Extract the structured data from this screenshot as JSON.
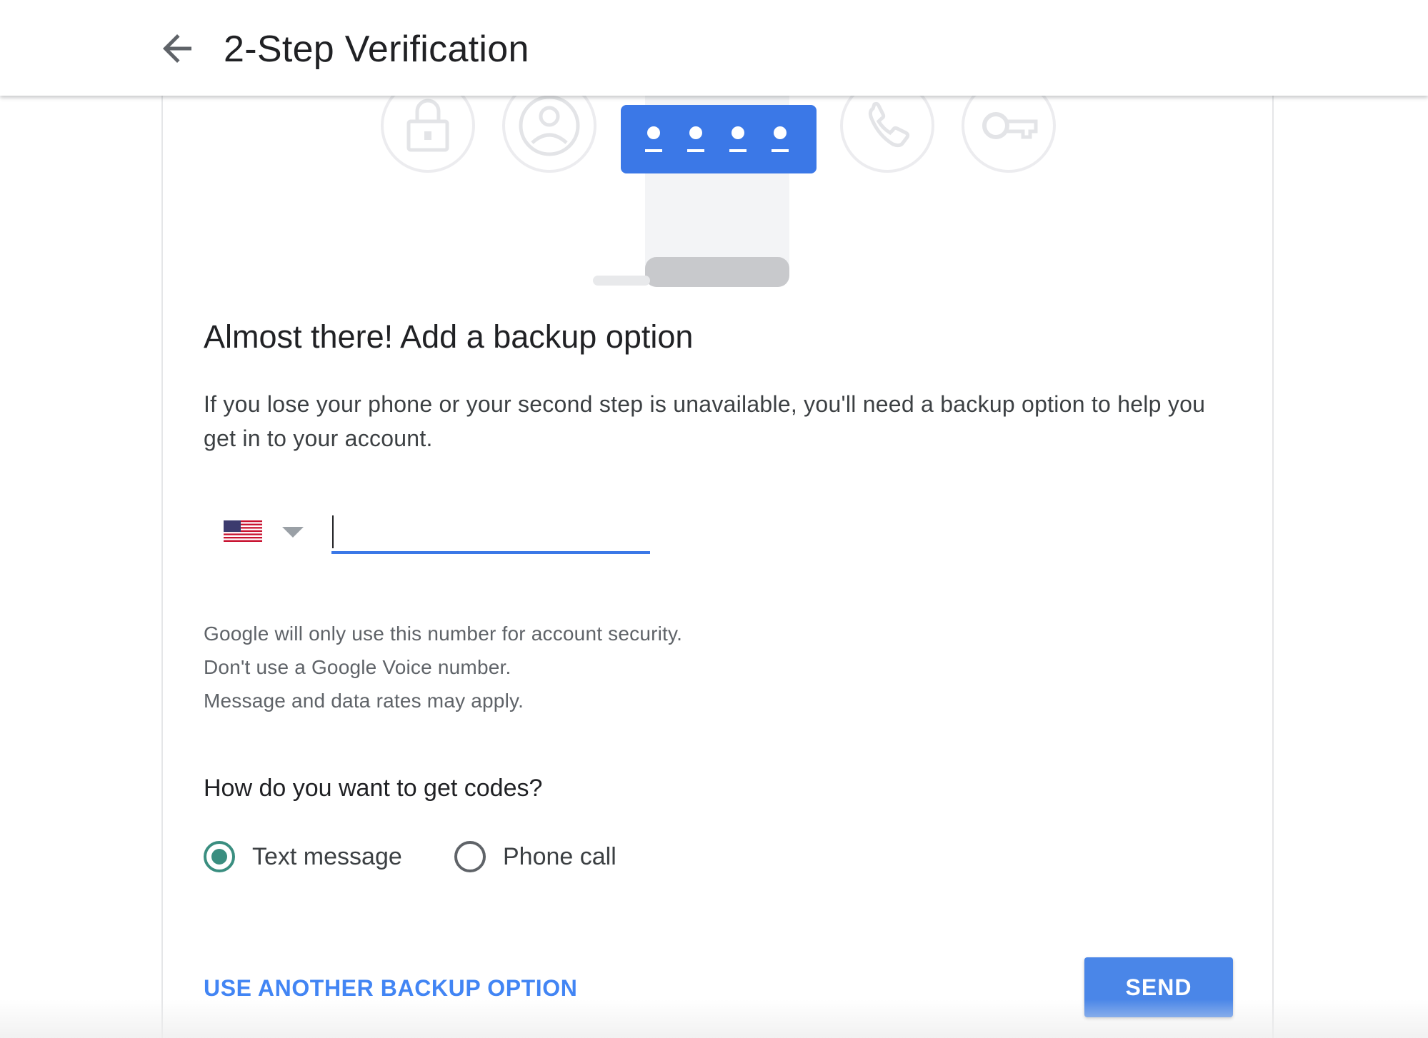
{
  "header": {
    "title": "2-Step Verification",
    "back_icon": "arrow-back-icon"
  },
  "illustration": {
    "icons": [
      "lock-icon",
      "person-icon",
      "password-dots-icon",
      "phone-icon",
      "key-icon"
    ],
    "accent_color": "#3b78e7"
  },
  "main": {
    "headline": "Almost there! Add a backup option",
    "description": "If you lose your phone or your second step is unavailable, you'll need a backup option to help you get in to your account.",
    "phone": {
      "country": "US",
      "flag_icon": "us-flag-icon",
      "dropdown_icon": "dropdown-triangle-icon",
      "value": "",
      "underline_color": "#3b78e7"
    },
    "notes": [
      "Google will only use this number for account security.",
      "Don't use a Google Voice number.",
      "Message and data rates may apply."
    ],
    "codes_question": "How do you want to get codes?",
    "code_options": [
      {
        "label": "Text message",
        "selected": true
      },
      {
        "label": "Phone call",
        "selected": false
      }
    ],
    "selected_color": "#3a8e80"
  },
  "footer": {
    "other_option": "USE ANOTHER BACKUP OPTION",
    "send": "SEND",
    "send_color": "#4a86e8"
  }
}
